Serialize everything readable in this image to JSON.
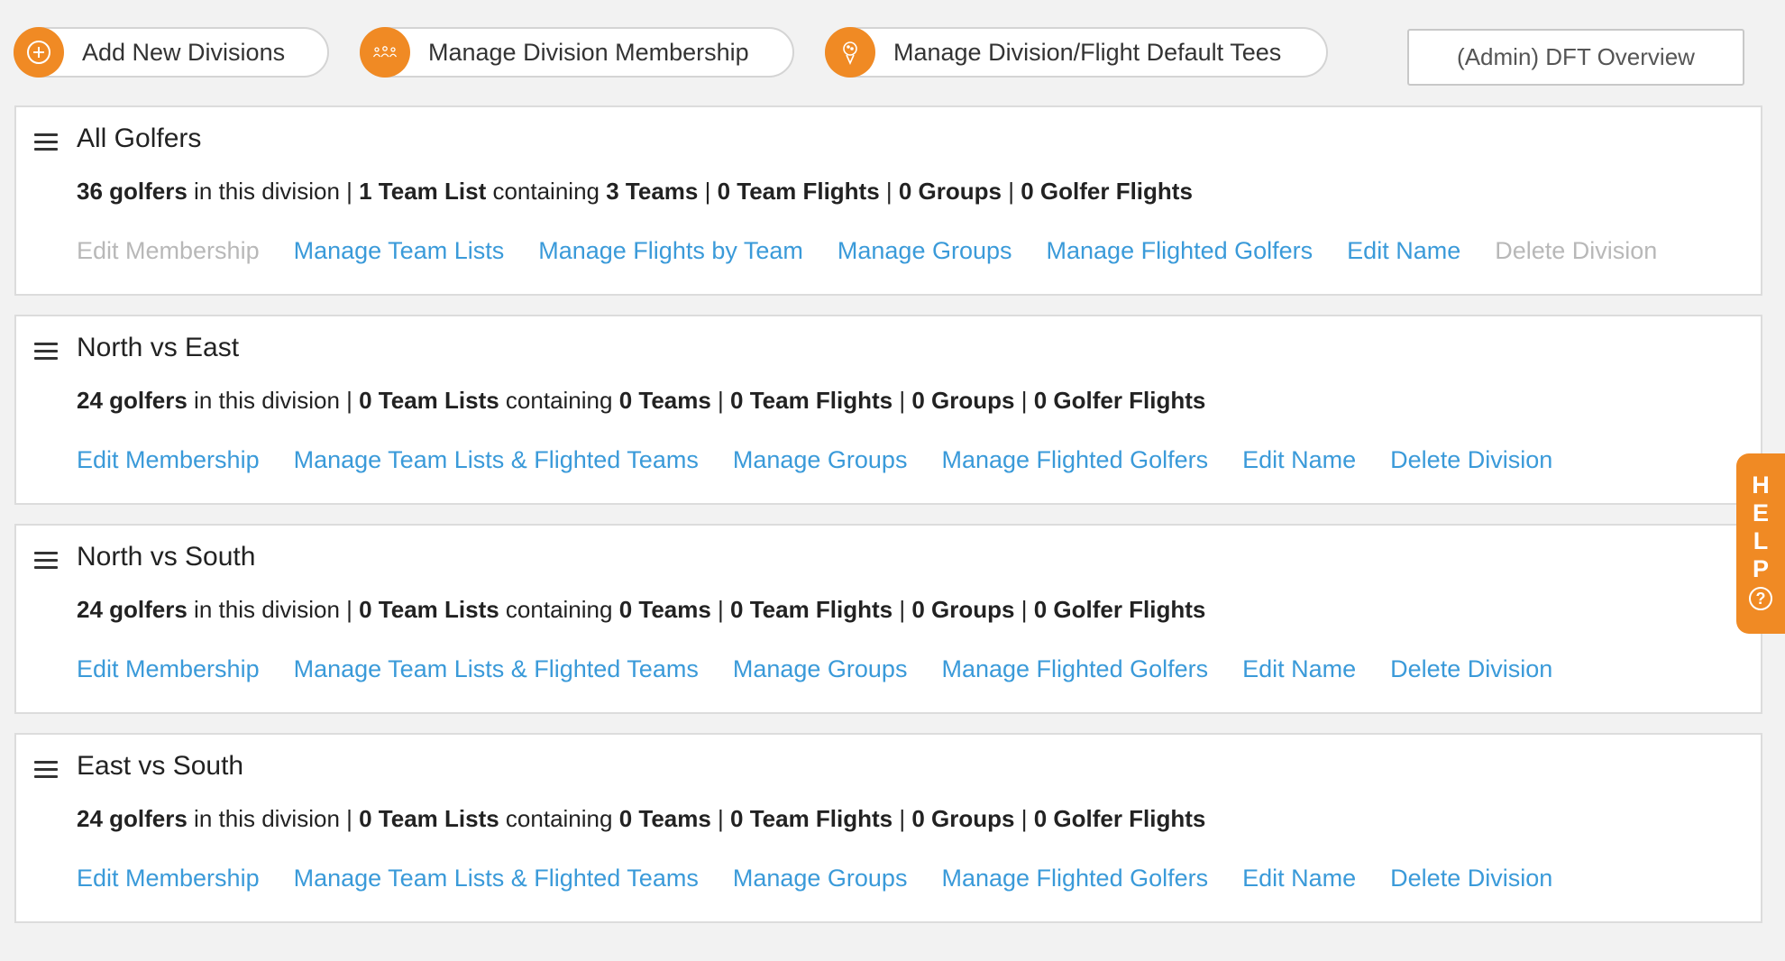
{
  "toolbar": {
    "add_divisions": "Add New Divisions",
    "manage_membership": "Manage Division Membership",
    "manage_tees": "Manage Division/Flight Default Tees",
    "admin_overview": "(Admin) DFT Overview"
  },
  "icons": {
    "add": "plus-circle-icon",
    "membership": "people-group-icon",
    "tees": "golf-tee-icon",
    "drag": "hamburger-icon",
    "help": "question-circle-icon"
  },
  "colors": {
    "accent": "#f08a24",
    "link": "#3a9ad9",
    "disabled_link": "#b8b8b8"
  },
  "divisions": [
    {
      "name": "All Golfers",
      "golfers": "36 golfers",
      "t1": " in this division | ",
      "team_lists": "1 Team List",
      "t2": " containing ",
      "teams": "3 Teams",
      "sep1": " | ",
      "team_flights": "0 Team Flights",
      "sep2": " | ",
      "groups": "0 Groups",
      "sep3": " | ",
      "golfer_flights": "0 Golfer Flights",
      "actions": [
        {
          "label": "Edit Membership",
          "disabled": true
        },
        {
          "label": "Manage Team Lists",
          "disabled": false
        },
        {
          "label": "Manage Flights by Team",
          "disabled": false
        },
        {
          "label": "Manage Groups",
          "disabled": false
        },
        {
          "label": "Manage Flighted Golfers",
          "disabled": false
        },
        {
          "label": "Edit Name",
          "disabled": false
        },
        {
          "label": "Delete Division",
          "disabled": true
        }
      ]
    },
    {
      "name": "North vs East",
      "golfers": "24 golfers",
      "t1": " in this division | ",
      "team_lists": "0 Team Lists",
      "t2": " containing ",
      "teams": "0 Teams",
      "sep1": " | ",
      "team_flights": "0 Team Flights",
      "sep2": " | ",
      "groups": "0 Groups",
      "sep3": " | ",
      "golfer_flights": "0 Golfer Flights",
      "actions": [
        {
          "label": "Edit Membership",
          "disabled": false
        },
        {
          "label": "Manage Team Lists & Flighted Teams",
          "disabled": false
        },
        {
          "label": "Manage Groups",
          "disabled": false
        },
        {
          "label": "Manage Flighted Golfers",
          "disabled": false
        },
        {
          "label": "Edit Name",
          "disabled": false
        },
        {
          "label": "Delete Division",
          "disabled": false
        }
      ]
    },
    {
      "name": "North vs South",
      "golfers": "24 golfers",
      "t1": " in this division | ",
      "team_lists": "0 Team Lists",
      "t2": " containing ",
      "teams": "0 Teams",
      "sep1": " | ",
      "team_flights": "0 Team Flights",
      "sep2": " | ",
      "groups": "0 Groups",
      "sep3": " | ",
      "golfer_flights": "0 Golfer Flights",
      "actions": [
        {
          "label": "Edit Membership",
          "disabled": false
        },
        {
          "label": "Manage Team Lists & Flighted Teams",
          "disabled": false
        },
        {
          "label": "Manage Groups",
          "disabled": false
        },
        {
          "label": "Manage Flighted Golfers",
          "disabled": false
        },
        {
          "label": "Edit Name",
          "disabled": false
        },
        {
          "label": "Delete Division",
          "disabled": false
        }
      ]
    },
    {
      "name": "East vs South",
      "golfers": "24 golfers",
      "t1": " in this division | ",
      "team_lists": "0 Team Lists",
      "t2": " containing ",
      "teams": "0 Teams",
      "sep1": " | ",
      "team_flights": "0 Team Flights",
      "sep2": " | ",
      "groups": "0 Groups",
      "sep3": " | ",
      "golfer_flights": "0 Golfer Flights",
      "actions": [
        {
          "label": "Edit Membership",
          "disabled": false
        },
        {
          "label": "Manage Team Lists & Flighted Teams",
          "disabled": false
        },
        {
          "label": "Manage Groups",
          "disabled": false
        },
        {
          "label": "Manage Flighted Golfers",
          "disabled": false
        },
        {
          "label": "Edit Name",
          "disabled": false
        },
        {
          "label": "Delete Division",
          "disabled": false
        }
      ]
    }
  ],
  "help": {
    "letters": [
      "H",
      "E",
      "L",
      "P"
    ],
    "question": "?"
  }
}
